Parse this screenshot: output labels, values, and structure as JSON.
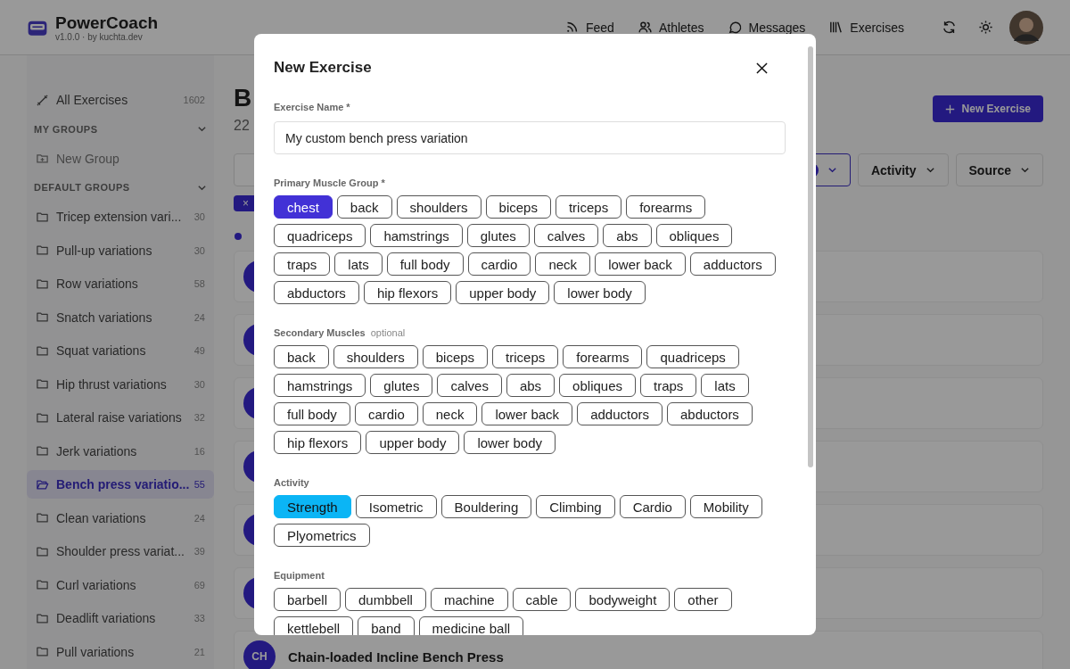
{
  "header": {
    "brand": "PowerCoach",
    "version": "v1.0.0 · by kuchta.dev",
    "nav": [
      {
        "label": "Feed",
        "kind": "feed"
      },
      {
        "label": "Athletes",
        "kind": "athletes"
      },
      {
        "label": "Messages",
        "kind": "messages"
      },
      {
        "label": "Exercises",
        "kind": "exercises"
      }
    ]
  },
  "sidebar": {
    "all": {
      "label": "All Exercises",
      "count": "1602"
    },
    "my_groups": {
      "title": "MY GROUPS",
      "new_group": "New Group"
    },
    "default_groups": {
      "title": "DEFAULT GROUPS",
      "items": [
        {
          "label": "Tricep extension vari...",
          "count": "30",
          "selected": false
        },
        {
          "label": "Pull-up variations",
          "count": "30",
          "selected": false
        },
        {
          "label": "Row variations",
          "count": "58",
          "selected": false
        },
        {
          "label": "Snatch variations",
          "count": "24",
          "selected": false
        },
        {
          "label": "Squat variations",
          "count": "49",
          "selected": false
        },
        {
          "label": "Hip thrust variations",
          "count": "30",
          "selected": false
        },
        {
          "label": "Lateral raise variations",
          "count": "32",
          "selected": false
        },
        {
          "label": "Jerk variations",
          "count": "16",
          "selected": false
        },
        {
          "label": "Bench press variatio...",
          "count": "55",
          "selected": true
        },
        {
          "label": "Clean variations",
          "count": "24",
          "selected": false
        },
        {
          "label": "Shoulder press variat...",
          "count": "39",
          "selected": false
        },
        {
          "label": "Curl variations",
          "count": "69",
          "selected": false
        },
        {
          "label": "Deadlift variations",
          "count": "33",
          "selected": false
        },
        {
          "label": "Pull variations",
          "count": "21",
          "selected": false
        }
      ]
    }
  },
  "main": {
    "title": "B",
    "subtitle": "22",
    "new_button": "New Exercise",
    "filters": [
      {
        "label": "Activity"
      },
      {
        "label": "Source"
      }
    ],
    "active_chip": "×",
    "cards": [
      {
        "kind": "covered"
      },
      {
        "kind": "covered"
      },
      {
        "kind": "covered"
      },
      {
        "kind": "covered"
      },
      {
        "kind": "covered"
      },
      {
        "kind": "covered"
      },
      {
        "kind": "full",
        "initials": "CH",
        "title": "Chain-loaded Incline Bench Press"
      }
    ]
  },
  "modal": {
    "title": "New Exercise",
    "name_field": {
      "label": "Exercise Name *",
      "value": "My custom bench press variation"
    },
    "sections": [
      {
        "label": "Primary Muscle Group *",
        "kind": "muscle",
        "chips": [
          {
            "label": "chest",
            "selected": true
          },
          {
            "label": "back",
            "selected": false
          },
          {
            "label": "shoulders",
            "selected": false
          },
          {
            "label": "biceps",
            "selected": false
          },
          {
            "label": "triceps",
            "selected": false
          },
          {
            "label": "forearms",
            "selected": false
          },
          {
            "label": "quadriceps",
            "selected": false
          },
          {
            "label": "hamstrings",
            "selected": false
          },
          {
            "label": "glutes",
            "selected": false
          },
          {
            "label": "calves",
            "selected": false
          },
          {
            "label": "abs",
            "selected": false
          },
          {
            "label": "obliques",
            "selected": false
          },
          {
            "label": "traps",
            "selected": false
          },
          {
            "label": "lats",
            "selected": false
          },
          {
            "label": "full body",
            "selected": false
          },
          {
            "label": "cardio",
            "selected": false
          },
          {
            "label": "neck",
            "selected": false
          },
          {
            "label": "lower back",
            "selected": false
          },
          {
            "label": "adductors",
            "selected": false
          },
          {
            "label": "abductors",
            "selected": false
          },
          {
            "label": "hip flexors",
            "selected": false
          },
          {
            "label": "upper body",
            "selected": false
          },
          {
            "label": "lower body",
            "selected": false
          }
        ]
      },
      {
        "label": "Secondary Muscles",
        "hint": "optional",
        "kind": "muscle",
        "chips": [
          {
            "label": "back",
            "selected": false
          },
          {
            "label": "shoulders",
            "selected": false
          },
          {
            "label": "biceps",
            "selected": false
          },
          {
            "label": "triceps",
            "selected": false
          },
          {
            "label": "forearms",
            "selected": false
          },
          {
            "label": "quadriceps",
            "selected": false
          },
          {
            "label": "hamstrings",
            "selected": false
          },
          {
            "label": "glutes",
            "selected": false
          },
          {
            "label": "calves",
            "selected": false
          },
          {
            "label": "abs",
            "selected": false
          },
          {
            "label": "obliques",
            "selected": false
          },
          {
            "label": "traps",
            "selected": false
          },
          {
            "label": "lats",
            "selected": false
          },
          {
            "label": "full body",
            "selected": false
          },
          {
            "label": "cardio",
            "selected": false
          },
          {
            "label": "neck",
            "selected": false
          },
          {
            "label": "lower back",
            "selected": false
          },
          {
            "label": "adductors",
            "selected": false
          },
          {
            "label": "abductors",
            "selected": false
          },
          {
            "label": "hip flexors",
            "selected": false
          },
          {
            "label": "upper body",
            "selected": false
          },
          {
            "label": "lower body",
            "selected": false
          }
        ]
      },
      {
        "label": "Activity",
        "kind": "activity",
        "chips": [
          {
            "label": "Strength",
            "selected": true
          },
          {
            "label": "Isometric",
            "selected": false
          },
          {
            "label": "Bouldering",
            "selected": false
          },
          {
            "label": "Climbing",
            "selected": false
          },
          {
            "label": "Cardio",
            "selected": false
          },
          {
            "label": "Mobility",
            "selected": false
          },
          {
            "label": "Plyometrics",
            "selected": false
          }
        ]
      },
      {
        "label": "Equipment",
        "kind": "equipment",
        "chips": [
          {
            "label": "barbell",
            "selected": false
          },
          {
            "label": "dumbbell",
            "selected": false
          },
          {
            "label": "machine",
            "selected": false
          },
          {
            "label": "cable",
            "selected": false
          },
          {
            "label": "bodyweight",
            "selected": false
          },
          {
            "label": "other",
            "selected": false
          },
          {
            "label": "kettlebell",
            "selected": false
          },
          {
            "label": "band",
            "selected": false
          },
          {
            "label": "medicine ball",
            "selected": false
          }
        ]
      }
    ]
  }
}
